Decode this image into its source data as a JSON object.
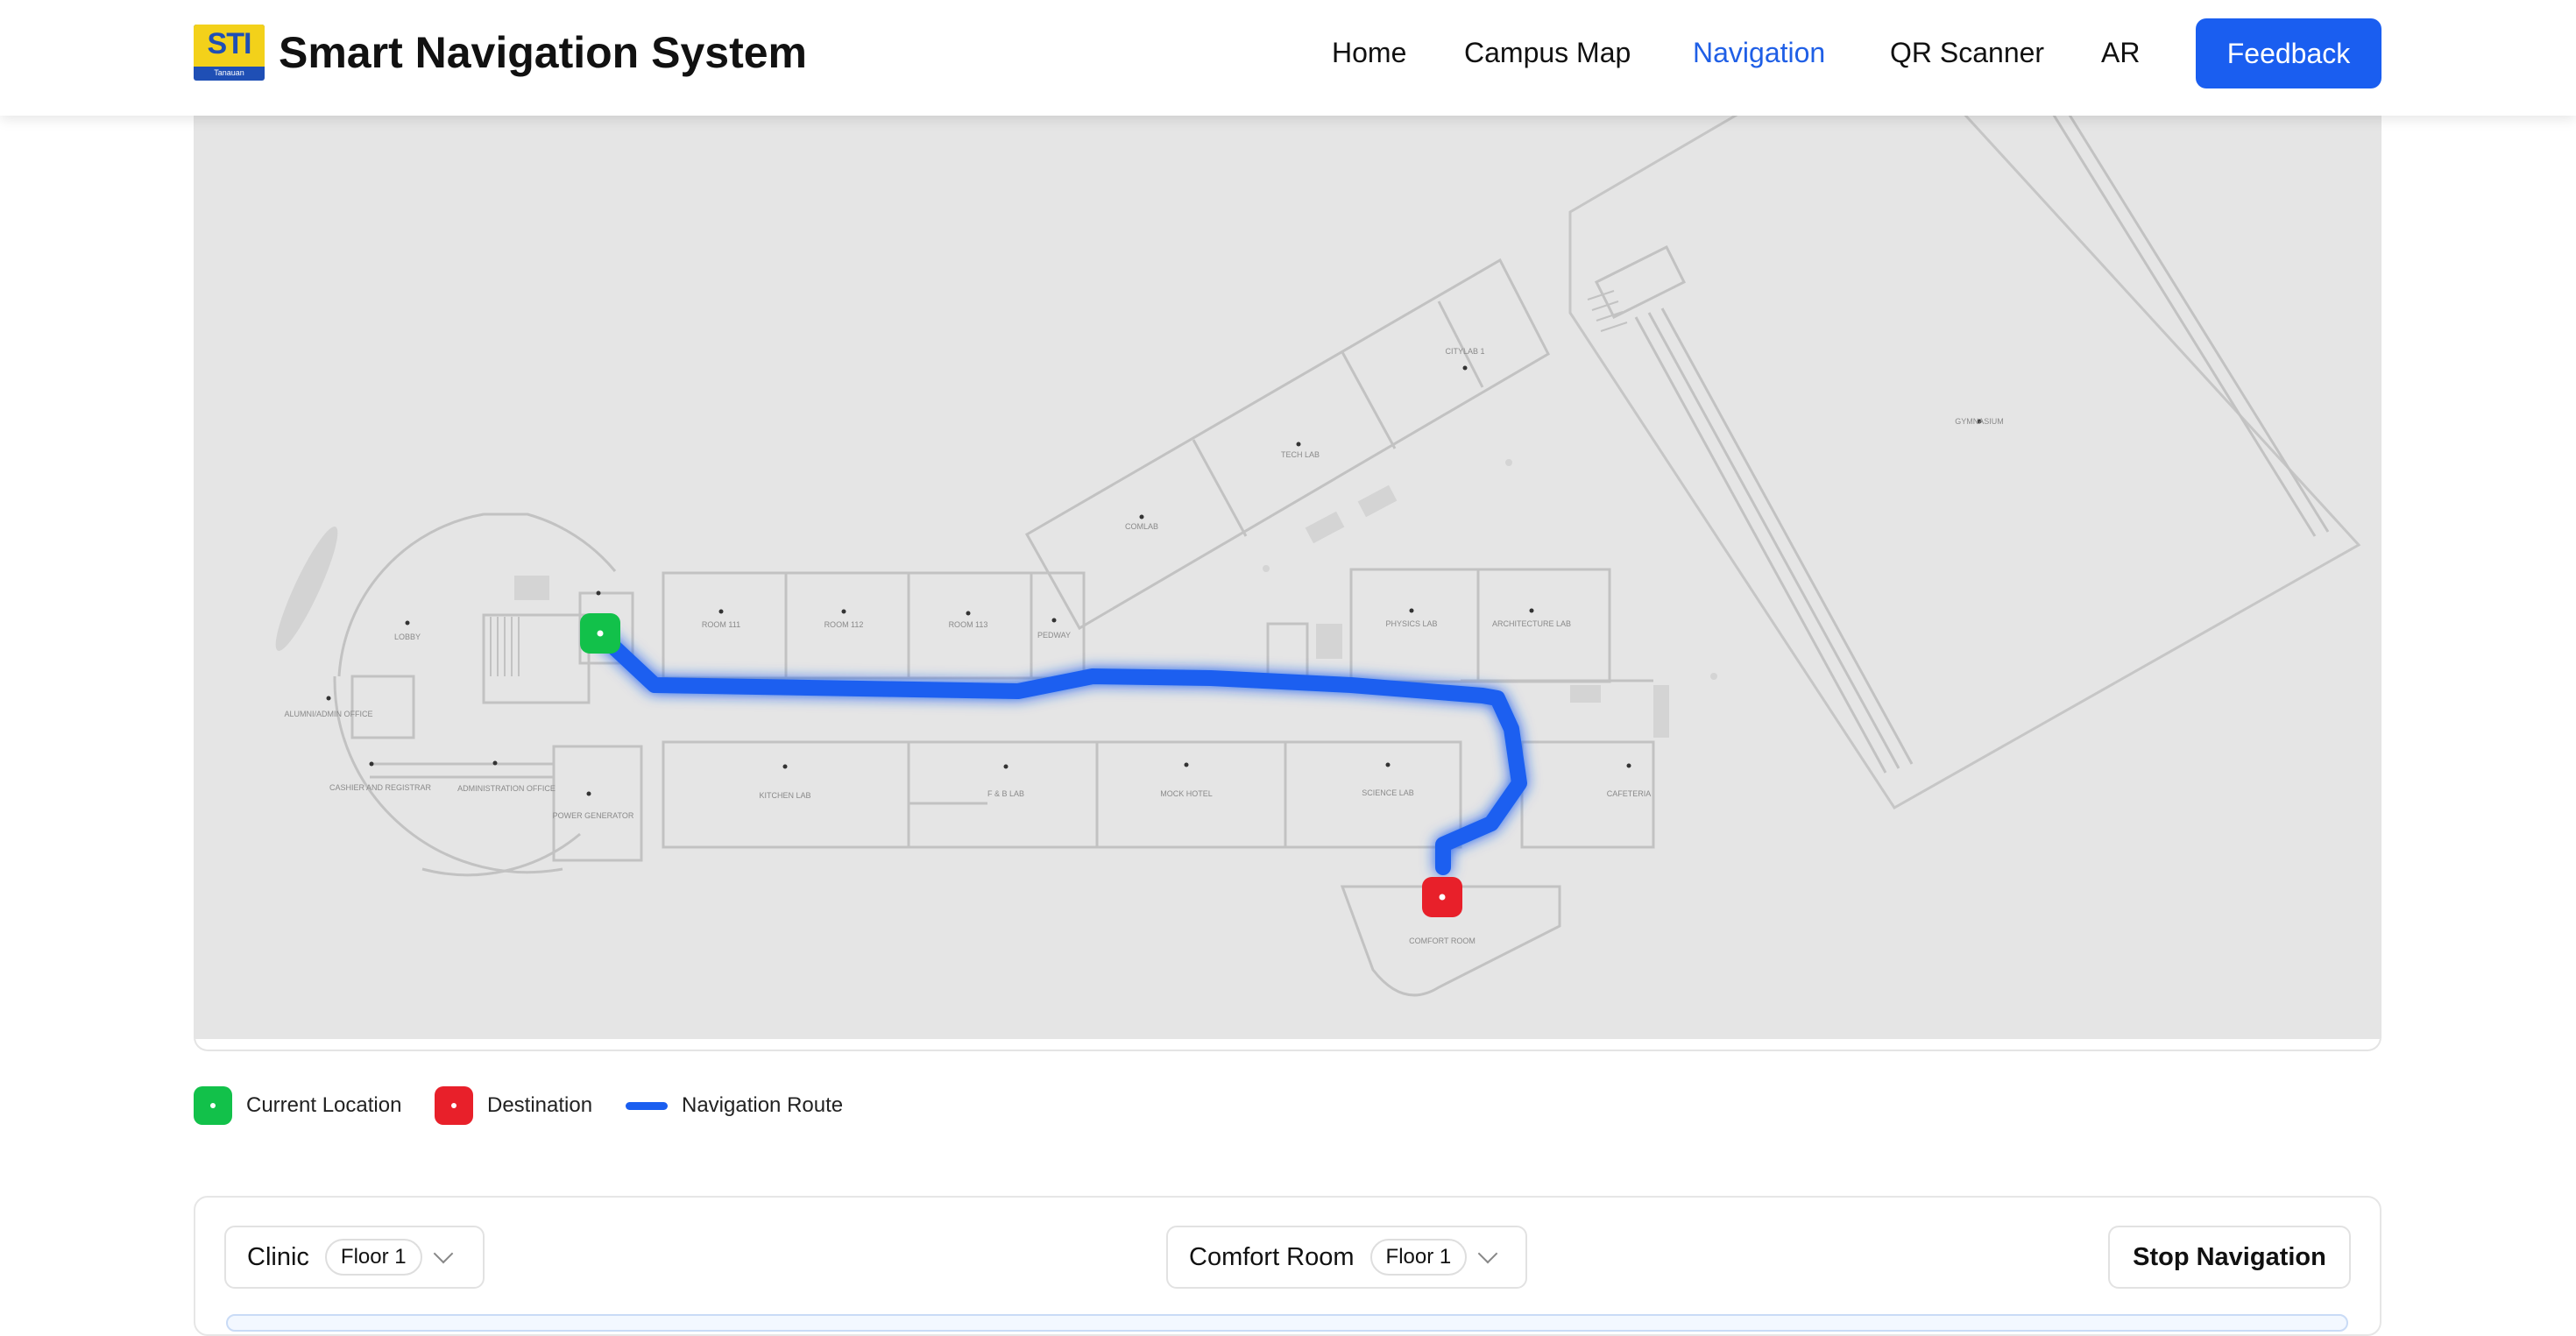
{
  "header": {
    "logo_text": "STI",
    "logo_subtext": "Tanauan",
    "title": "Smart Navigation System",
    "nav": [
      "Home",
      "Campus Map",
      "Navigation",
      "QR Scanner",
      "AR"
    ],
    "active_nav": "Navigation",
    "feedback_label": "Feedback"
  },
  "map": {
    "rooms": [
      "LOBBY",
      "ALUMNI/ADMIN OFFICE",
      "CASHIER AND REGISTRAR",
      "ADMINISTRATION OFFICE",
      "POWER GENERATOR",
      "ROOM 111",
      "ROOM 112",
      "ROOM 113",
      "PEDWAY",
      "COMLAB",
      "TECH LAB",
      "CITYLAB 1",
      "PHYSICS LAB",
      "ARCHITECTURE LAB",
      "KITCHEN LAB",
      "F & B LAB",
      "MOCK HOTEL",
      "SCIENCE LAB",
      "CAFETERIA",
      "COMFORT ROOM",
      "GYMNASIUM"
    ],
    "current_location": "Clinic",
    "destination": "Comfort Room"
  },
  "legend": {
    "current": "Current Location",
    "destination": "Destination",
    "route": "Navigation Route"
  },
  "controls": {
    "from_place": "Clinic",
    "from_floor": "Floor 1",
    "to_place": "Comfort Room",
    "to_floor": "Floor 1",
    "stop_label": "Stop Navigation"
  },
  "colors": {
    "accent": "#1a5ef0",
    "current": "#12c14a",
    "destination": "#e8202a",
    "map_bg": "#e5e5e5"
  }
}
